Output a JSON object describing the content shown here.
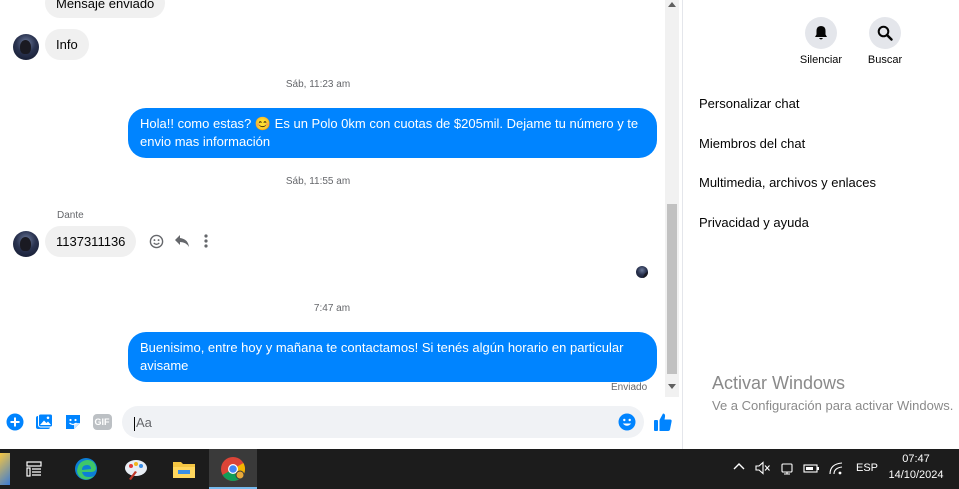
{
  "chat": {
    "top_partial_message": "Mensaje enviado",
    "info_message": "Info",
    "timestamp_1": "Sáb, 11:23 am",
    "outgoing_1": "Hola!! como estas? 😊 Es un Polo 0km con cuotas de $205mil. Dejame tu número y te envio mas información",
    "timestamp_2": "Sáb, 11:55 am",
    "sender_name": "Dante",
    "incoming_2": "1137311136",
    "timestamp_3": "7:47 am",
    "outgoing_2": "Buenisimo, entre hoy y mañana te contactamos! Si tenés algún horario en particular avisame",
    "status": "Enviado"
  },
  "composer": {
    "placeholder": "Aa",
    "gif_label": "GIF"
  },
  "right_panel": {
    "mute_label": "Silenciar",
    "search_label": "Buscar",
    "menu": [
      "Personalizar chat",
      "Miembros del chat",
      "Multimedia, archivos y enlaces",
      "Privacidad y ayuda"
    ],
    "watermark_title": "Activar Windows",
    "watermark_sub": "Ve a Configuración para activar Windows."
  },
  "taskbar": {
    "language": "ESP",
    "time": "07:47",
    "date": "14/10/2024"
  },
  "colors": {
    "accent": "#0084ff",
    "bubble_in": "#f0f0f0",
    "taskbar": "#1c1c1c"
  },
  "icons": [
    "plus-circle-icon",
    "image-icon",
    "sticker-icon",
    "gif-icon",
    "emoji-icon",
    "like-icon",
    "bell-icon",
    "search-icon",
    "react-icon",
    "reply-icon",
    "more-icon",
    "task-view-icon",
    "edge-icon",
    "paint-icon",
    "file-explorer-icon",
    "chrome-icon"
  ]
}
